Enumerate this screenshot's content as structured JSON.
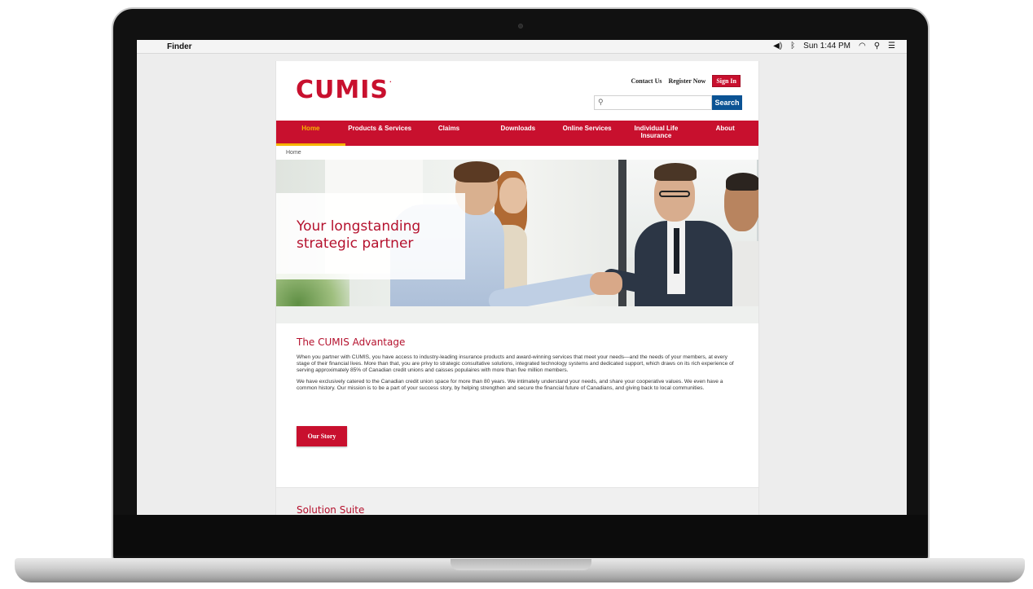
{
  "menubar": {
    "app_name": "Finder",
    "clock": "Sun 1:44 PM"
  },
  "site": {
    "logo_text": "CUMIS",
    "logo_mark": "·",
    "top_links": {
      "contact": "Contact Us",
      "register": "Register Now",
      "sign_in": "Sign In"
    },
    "search": {
      "placeholder": "",
      "button_label": "Search"
    },
    "nav": [
      {
        "label": "Home",
        "active": true
      },
      {
        "label": "Products & Services"
      },
      {
        "label": "Claims"
      },
      {
        "label": "Downloads"
      },
      {
        "label": "Online Services"
      },
      {
        "label": "Individual Life Insurance"
      },
      {
        "label": "About"
      }
    ],
    "breadcrumb": "Home",
    "hero": {
      "title_line1": "Your longstanding",
      "title_line2": "strategic partner"
    },
    "advantage": {
      "heading": "The CUMIS Advantage",
      "para1": "When you partner with CUMIS, you have access to industry-leading insurance products and award-winning services that meet your needs—and the needs of your members, at every stage of their financial lives. More than that, you are privy to strategic consultative solutions, integrated technology systems and dedicated support, which draws on its rich experience of serving approximately 85% of Canadian credit unions and caisses populaires with more than five million members.",
      "para2": "We have exclusively catered to the Canadian credit union space for more than 80 years. We intimately understand your needs, and share your cooperative values. We even have a common history. Our mission is to be a part of your success story, by helping strengthen and secure the financial future of Canadians, and giving back to local communities.",
      "button_label": "Our Story"
    },
    "suite_heading": "Solution Suite"
  },
  "colors": {
    "brand_red": "#c8102e",
    "search_blue": "#0b5394",
    "nav_active": "#f5b400"
  }
}
